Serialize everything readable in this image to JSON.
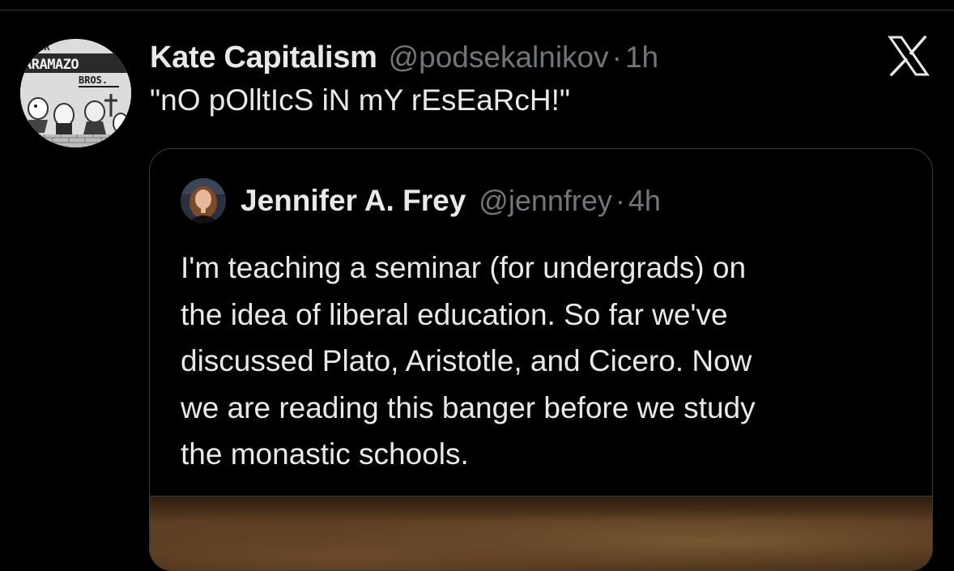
{
  "tweet": {
    "author": {
      "display_name": "Kate Capitalism",
      "handle": "@podsekalnikov",
      "avatar_text": {
        "top": "ER",
        "middle": "ARAMAZO",
        "bottom": "BROS."
      }
    },
    "separator": "·",
    "time": "1h",
    "text": "\"nO pOlltIcS iN mY rEsEaRcH!\""
  },
  "brand": {
    "icon": "x-logo-icon"
  },
  "quoted_tweet": {
    "author": {
      "display_name": "Jennifer A. Frey",
      "handle": "@jennfrey"
    },
    "separator": "·",
    "time": "4h",
    "text_lines": [
      "I'm teaching a seminar (for undergrads) on",
      "the idea of liberal education. So far we've",
      "discussed Plato, Aristotle, and Cicero. Now",
      "we are reading this banger before we study",
      "the monastic schools."
    ]
  },
  "colors": {
    "background": "#000000",
    "primary_text": "#e7e9ea",
    "secondary_text": "#71767b",
    "border": "#3a3d40"
  }
}
